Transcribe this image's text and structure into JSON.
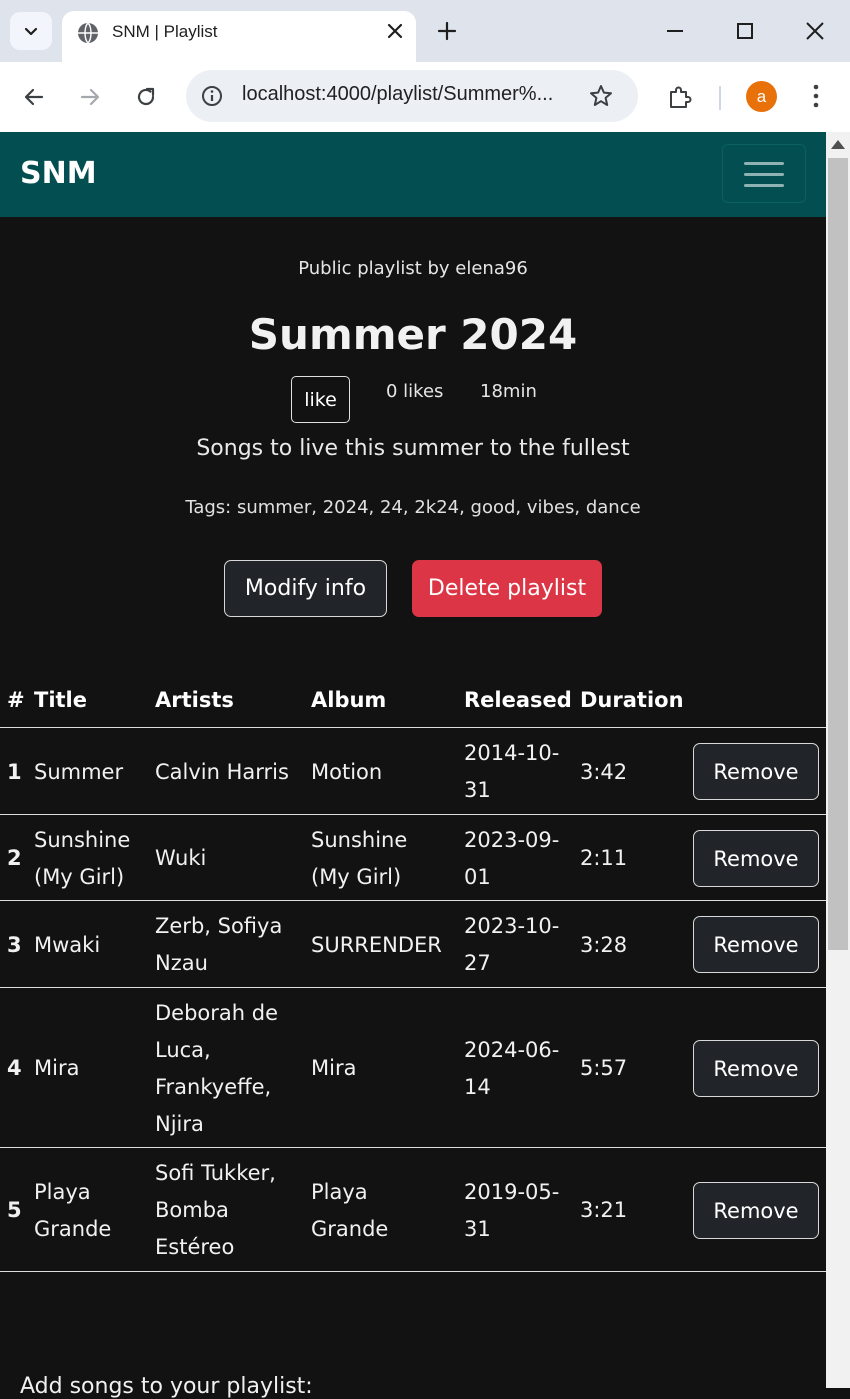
{
  "browser": {
    "tab_title": "SNM | Playlist",
    "url": "localhost:4000/playlist/Summer%...",
    "avatar_letter": "a"
  },
  "navbar": {
    "brand": "SNM"
  },
  "playlist": {
    "owner_line": "Public playlist by elena96",
    "title": "Summer 2024",
    "like_label": "like",
    "likes": "0 likes",
    "duration": "18min",
    "description": "Songs to live this summer to the fullest",
    "tags": "Tags: summer, 2024, 24, 2k24, good, vibes, dance",
    "modify_label": "Modify info",
    "delete_label": "Delete playlist"
  },
  "table": {
    "headers": [
      "#",
      "Title",
      "Artists",
      "Album",
      "Released",
      "Duration"
    ],
    "remove_label": "Remove",
    "rows": [
      {
        "num": "1",
        "title": "Summer",
        "artists": "Calvin Harris",
        "album": "Motion",
        "released": "2014-10-31",
        "duration": "3:42"
      },
      {
        "num": "2",
        "title": "Sunshine (My Girl)",
        "artists": "Wuki",
        "album": "Sunshine (My Girl)",
        "released": "2023-09-01",
        "duration": "2:11"
      },
      {
        "num": "3",
        "title": "Mwaki",
        "artists": "Zerb, Sofiya Nzau",
        "album": "SURRENDER",
        "released": "2023-10-27",
        "duration": "3:28"
      },
      {
        "num": "4",
        "title": "Mira",
        "artists": "Deborah de Luca, Frankyeffe, Njira",
        "album": "Mira",
        "released": "2024-06-14",
        "duration": "5:57"
      },
      {
        "num": "5",
        "title": "Playa Grande",
        "artists": "Sofi Tukker, Bomba Estéreo",
        "album": "Playa Grande",
        "released": "2019-05-31",
        "duration": "3:21"
      }
    ]
  },
  "add_songs_label": "Add songs to your playlist:",
  "colors": {
    "navbar": "#024e50",
    "background": "#121212",
    "delete": "#dc3545",
    "button_dark": "#212529"
  }
}
